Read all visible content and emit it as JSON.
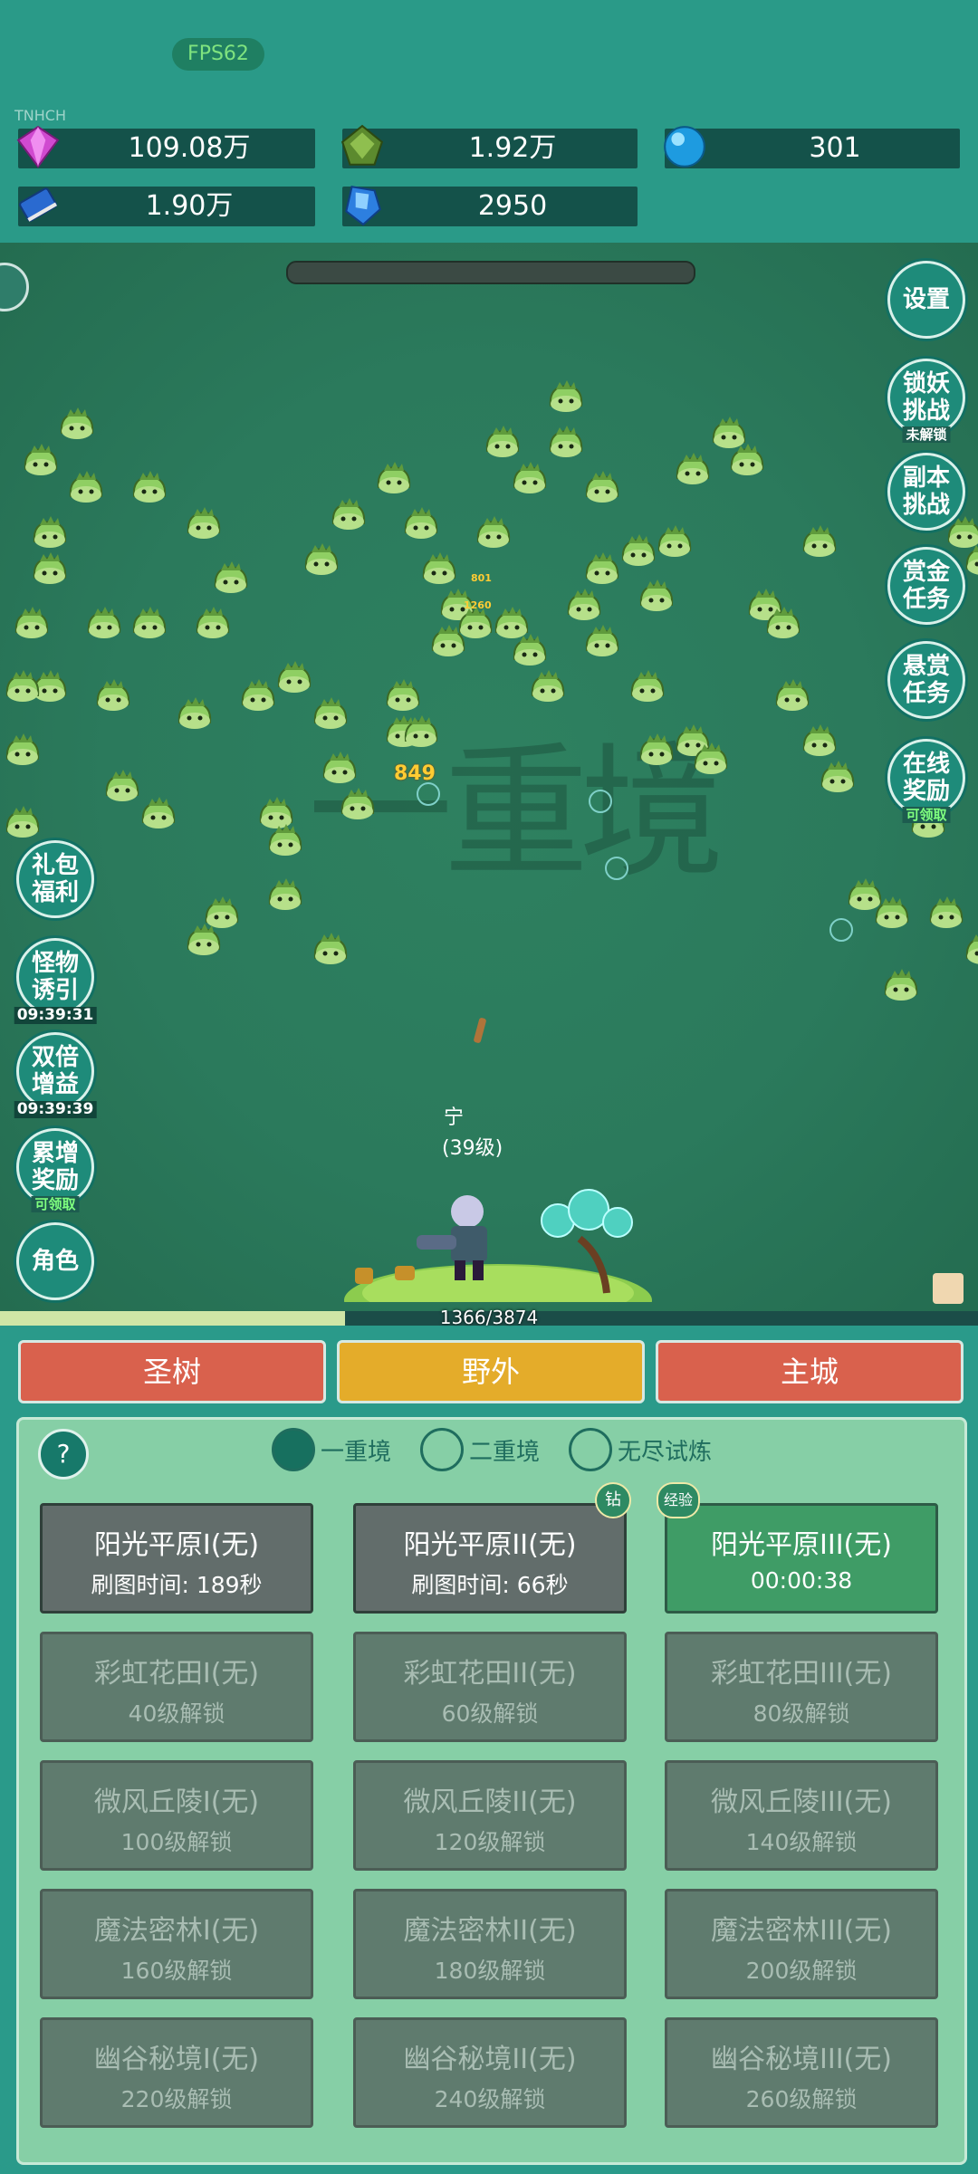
{
  "fps": "FPS62",
  "tiny_label": "TNHCH",
  "resources": {
    "diamond": "109.08万",
    "emerald": "1.92万",
    "orb": "301",
    "book": "1.90万",
    "crystal": "2950"
  },
  "right_menu": {
    "settings": "设置",
    "lock_demon": "锁妖挑战",
    "lock_demon_status": "未解锁",
    "dungeon": "副本挑战",
    "bounty_task": "赏金任务",
    "reward_task": "悬赏任务",
    "online_reward": "在线奖励",
    "online_reward_status": "可领取"
  },
  "left_menu": {
    "gift": "礼包福利",
    "monster_lure": "怪物诱引",
    "monster_lure_timer": "09:39:31",
    "double_buff": "双倍增益",
    "double_buff_timer": "09:39:39",
    "cumulative": "累增奖励",
    "cumulative_status": "可领取",
    "character": "角色"
  },
  "watermark": "一重境",
  "player": {
    "name": "宁",
    "level": "(39级)"
  },
  "damage": [
    "849",
    "801",
    "1260"
  ],
  "xp": {
    "text": "1366/3874",
    "fraction": 0.3526
  },
  "tabs": {
    "tree": "圣树",
    "field": "野外",
    "city": "主城"
  },
  "help": "?",
  "realms": {
    "r1": "一重境",
    "r2": "二重境",
    "r3": "无尽试炼"
  },
  "zones": [
    {
      "name": "阳光平原I(无)",
      "sub": "刷图时间: 189秒"
    },
    {
      "name": "阳光平原II(无)",
      "sub": "刷图时间: 66秒",
      "badge": "钻"
    },
    {
      "name": "阳光平原III(无)",
      "sub": "00:00:38",
      "badge": "经验"
    },
    {
      "name": "彩虹花田I(无)",
      "sub": "40级解锁"
    },
    {
      "name": "彩虹花田II(无)",
      "sub": "60级解锁"
    },
    {
      "name": "彩虹花田III(无)",
      "sub": "80级解锁"
    },
    {
      "name": "微风丘陵I(无)",
      "sub": "100级解锁"
    },
    {
      "name": "微风丘陵II(无)",
      "sub": "120级解锁"
    },
    {
      "name": "微风丘陵III(无)",
      "sub": "140级解锁"
    },
    {
      "name": "魔法密林I(无)",
      "sub": "160级解锁"
    },
    {
      "name": "魔法密林II(无)",
      "sub": "180级解锁"
    },
    {
      "name": "魔法密林III(无)",
      "sub": "200级解锁"
    },
    {
      "name": "幽谷秘境I(无)",
      "sub": "220级解锁"
    },
    {
      "name": "幽谷秘境II(无)",
      "sub": "240级解锁"
    },
    {
      "name": "幽谷秘境III(无)",
      "sub": "260级解锁"
    }
  ],
  "colors": {
    "tab_red": "#d9614d",
    "tab_yellow": "#e4ac2a",
    "panel": "#86cfa6"
  }
}
